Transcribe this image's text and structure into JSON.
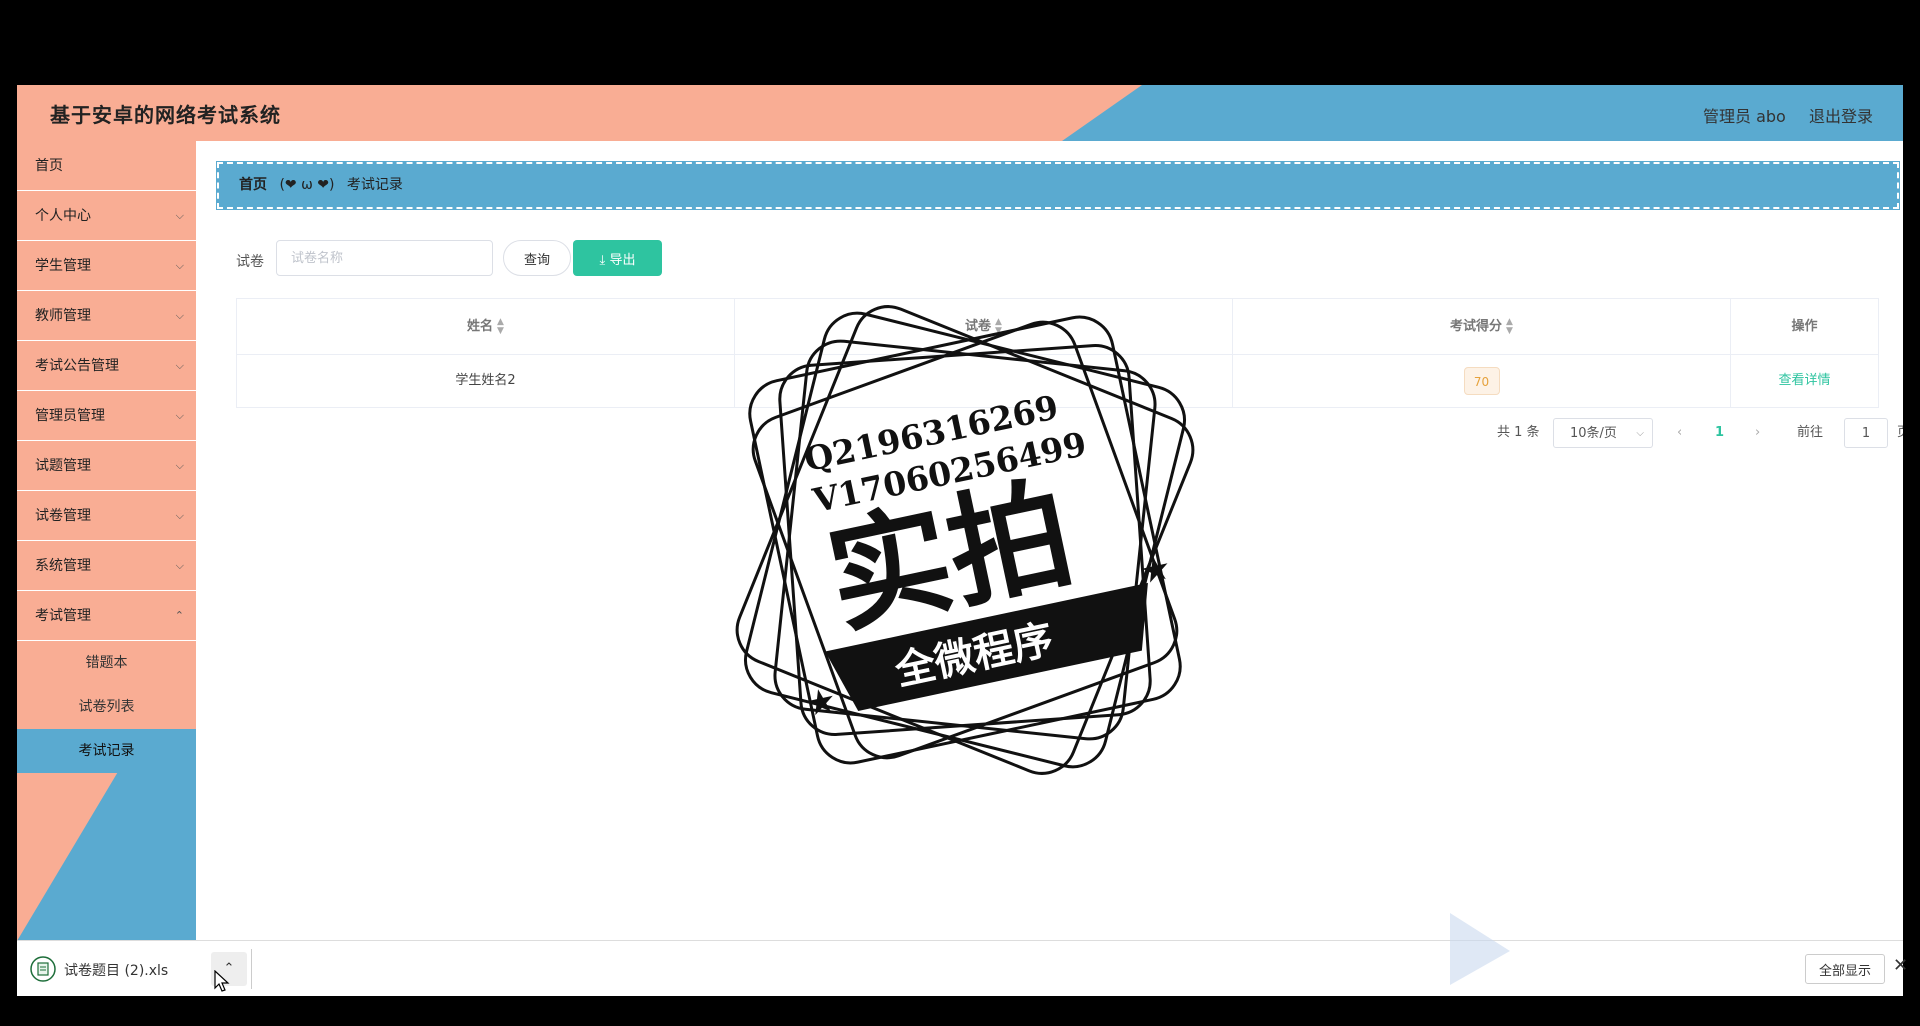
{
  "header": {
    "app_title": "基于安卓的网络考试系统",
    "user_label": "管理员 abo",
    "logout_label": "退出登录",
    "colors": {
      "salmon": "#f9ad94",
      "blue": "#5aaad0"
    }
  },
  "sidebar": {
    "items": [
      {
        "label": "首页",
        "has_chevron": false
      },
      {
        "label": "个人中心",
        "has_chevron": true
      },
      {
        "label": "学生管理",
        "has_chevron": true
      },
      {
        "label": "教师管理",
        "has_chevron": true
      },
      {
        "label": "考试公告管理",
        "has_chevron": true
      },
      {
        "label": "管理员管理",
        "has_chevron": true
      },
      {
        "label": "试题管理",
        "has_chevron": true
      },
      {
        "label": "试卷管理",
        "has_chevron": true
      },
      {
        "label": "系统管理",
        "has_chevron": true
      },
      {
        "label": "考试管理",
        "has_chevron": true,
        "expanded": true
      }
    ],
    "sub_items": [
      {
        "label": "错题本"
      },
      {
        "label": "试卷列表"
      },
      {
        "label": "考试记录",
        "active": true
      }
    ]
  },
  "breadcrumb": {
    "home": "首页",
    "separator": "(❤ ω ❤)",
    "current": "考试记录"
  },
  "search": {
    "label": "试卷",
    "placeholder": "试卷名称",
    "query_label": "查询",
    "export_label": "导出"
  },
  "table": {
    "columns": [
      "姓名",
      "试卷",
      "考试得分",
      "操作"
    ],
    "rows": [
      {
        "name": "学生姓名2",
        "paper": "",
        "score": "70",
        "action": "查看详情"
      }
    ]
  },
  "pagination": {
    "total": "共 1 条",
    "page_size": "10条/页",
    "current_page": "1",
    "goto_label": "前往",
    "goto_value": "1",
    "page_suffix": "页"
  },
  "download_bar": {
    "file_name": "试卷题目 (2).xls",
    "show_all_label": "全部显示"
  },
  "watermark": {
    "line1": "Q2196316269",
    "line2": "V17060256499",
    "main": "实拍",
    "banner": "全微程序"
  }
}
